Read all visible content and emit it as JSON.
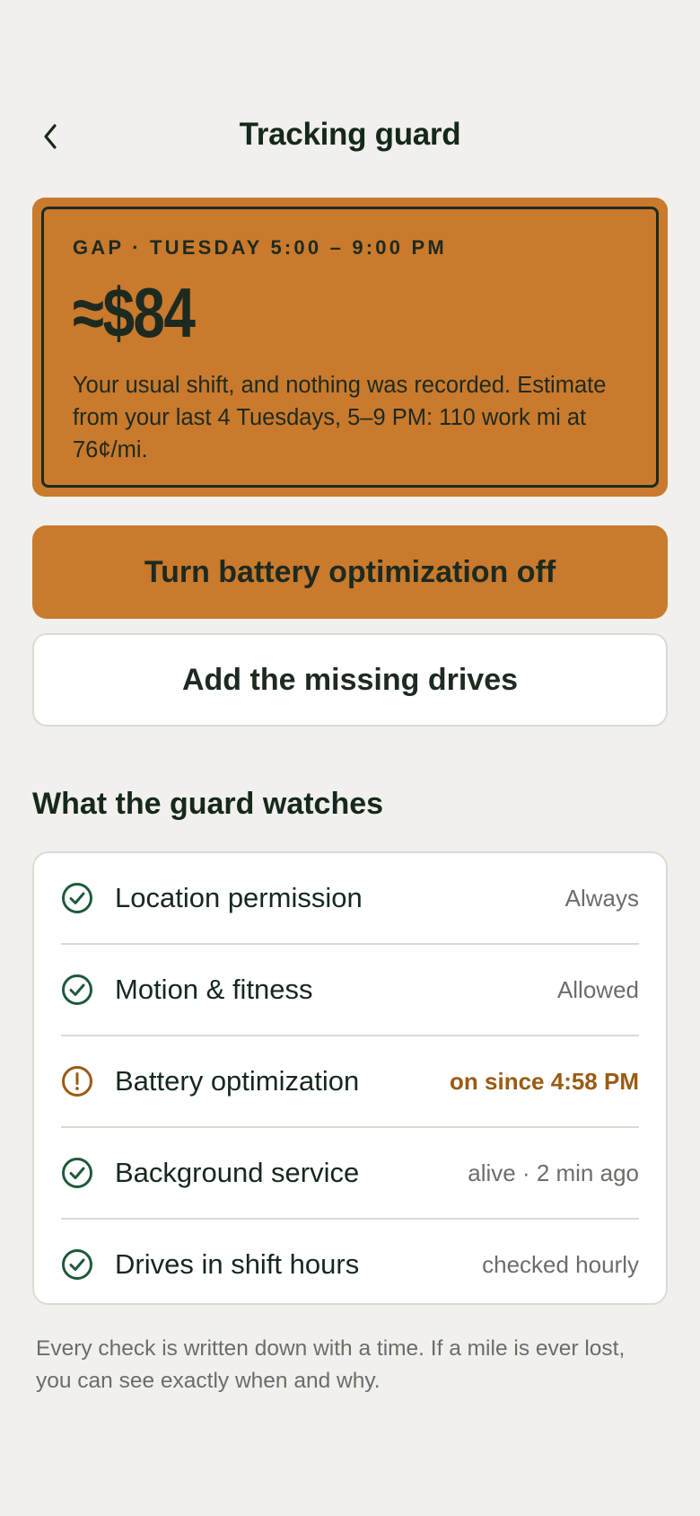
{
  "header": {
    "title": "Tracking guard",
    "back_icon": "chevron-left-icon"
  },
  "gap": {
    "label": "GAP · TUESDAY 5:00 – 9:00 PM",
    "amount": "≈$84",
    "description": "Your usual shift, and nothing was recorded. Estimate from your last 4 Tuesdays, 5–9 PM: 110 work mi at 76¢/mi."
  },
  "actions": {
    "primary_label": "Turn battery optimization off",
    "secondary_label": "Add the missing drives"
  },
  "watches": {
    "title": "What the guard watches",
    "items": [
      {
        "label": "Location permission",
        "value": "Always",
        "status": "ok",
        "icon": "check-circle-icon"
      },
      {
        "label": "Motion & fitness",
        "value": "Allowed",
        "status": "ok",
        "icon": "check-circle-icon"
      },
      {
        "label": "Battery optimization",
        "value": "on since 4:58 PM",
        "status": "warning",
        "icon": "alert-circle-icon"
      },
      {
        "label": "Background service",
        "value": "alive · 2 min ago",
        "status": "ok",
        "icon": "check-circle-icon"
      },
      {
        "label": "Drives in shift hours",
        "value": "checked hourly",
        "status": "ok",
        "icon": "check-circle-icon"
      }
    ]
  },
  "footnote": "Every check is written down with a time. If a mile is ever lost, you can see exactly when and why.",
  "colors": {
    "background": "#f1f0ec",
    "accent": "#c97a2c",
    "ok": "#1f5a3a",
    "warning": "#9a5b13",
    "text": "#16281d"
  }
}
